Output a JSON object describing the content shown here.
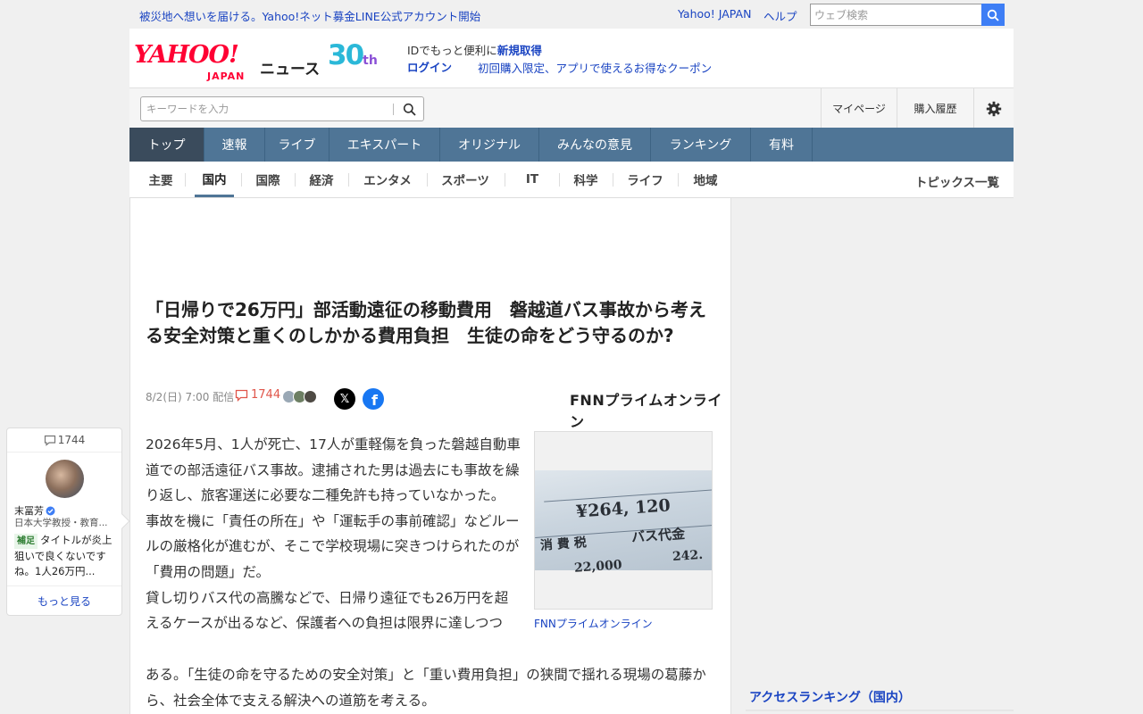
{
  "topbar": {
    "promo": "被災地へ想いを届ける。Yahoo!ネット募金LINE公式アカウント開始",
    "yahoo_japan": "Yahoo! JAPAN",
    "help": "ヘルプ",
    "web_search_placeholder": "ウェブ検索"
  },
  "header": {
    "logo_yahoo": "YAHOO!",
    "logo_japan": "JAPAN",
    "logo_news": "ニュース",
    "badge_num": "30",
    "badge_th": "th",
    "id_text": "IDでもっと便利に",
    "id_register": "新規取得",
    "login": "ログイン",
    "coupon": "初回購入限定、アプリで使えるお得なクーポン"
  },
  "search": {
    "placeholder": "キーワードを入力",
    "mypage": "マイページ",
    "purchase_history": "購入履歴"
  },
  "main_nav": [
    {
      "label": "トップ",
      "active": true
    },
    {
      "label": "速報",
      "active": false
    },
    {
      "label": "ライブ",
      "active": false
    },
    {
      "label": "エキスパート",
      "active": false
    },
    {
      "label": "オリジナル",
      "active": false
    },
    {
      "label": "みんなの意見",
      "active": false
    },
    {
      "label": "ランキング",
      "active": false
    },
    {
      "label": "有料",
      "active": false
    }
  ],
  "sub_nav": [
    {
      "label": "主要",
      "active": false
    },
    {
      "label": "国内",
      "active": true
    },
    {
      "label": "国際",
      "active": false
    },
    {
      "label": "経済",
      "active": false
    },
    {
      "label": "エンタメ",
      "active": false
    },
    {
      "label": "スポーツ",
      "active": false
    },
    {
      "label": "IT",
      "active": false
    },
    {
      "label": "科学",
      "active": false
    },
    {
      "label": "ライフ",
      "active": false
    },
    {
      "label": "地域",
      "active": false
    }
  ],
  "topics_list": "トピックス一覧",
  "article": {
    "title": "「日帰りで26万円」部活動遠征の移動費用　磐越道バス事故から考える安全対策と重くのしかかる費用負担　生徒の命をどう守るのか?",
    "date": "8/2(日) 7:00",
    "delivered": "配信",
    "comment_count": "1744",
    "source": "FNNプライムオンライン",
    "source_logo": "FNNプライムオンライン",
    "paragraphs": [
      "2026年5月、1人が死亡、17人が重軽傷を負った磐越自動車道での部活遠征バス事故。逮捕された男は過去にも事故を繰り返し、旅客運送に必要な二種免許も持っていなかった。",
      "事故を機に「責任の所在」や「運転手の事前確認」などルールの厳格化が進むが、そこで学校現場に突きつけられたのが「費用の問題」だ。",
      "貸し切りバス代の高騰などで、日帰り遠征でも26万円を超えるケースが出るなど、保護者への負担は限界に達しつつ"
    ],
    "paragraph_wide": "ある。「生徒の命を守るための安全対策」と「重い費用負担」の狭間で揺れる現場の葛藤から、社会全体で支える解決への道筋を考える。",
    "photo": {
      "amount": "¥264, 120",
      "tax": "消 費 税",
      "bus_fee": "バス代金",
      "num1": "242.",
      "num2": "22,000"
    },
    "photo_caption": "FNNプライムオンライン"
  },
  "right": {
    "ranking_title": "アクセスランキング（国内）"
  },
  "comment_card": {
    "count": "1744",
    "name": "末冨芳",
    "role": "日本大学教授・教育...",
    "tag": "補足",
    "text": "タイトルが炎上狙いで良くないですね。1人26万円...",
    "more": "もっと見る"
  },
  "colors": {
    "link": "#1a44c2",
    "nav_bg": "#4f7596",
    "nav_active": "#3a4b5c",
    "accent_red": "#ff0033",
    "comment_red": "#e0554a",
    "search_btn": "#3e7ef5"
  }
}
